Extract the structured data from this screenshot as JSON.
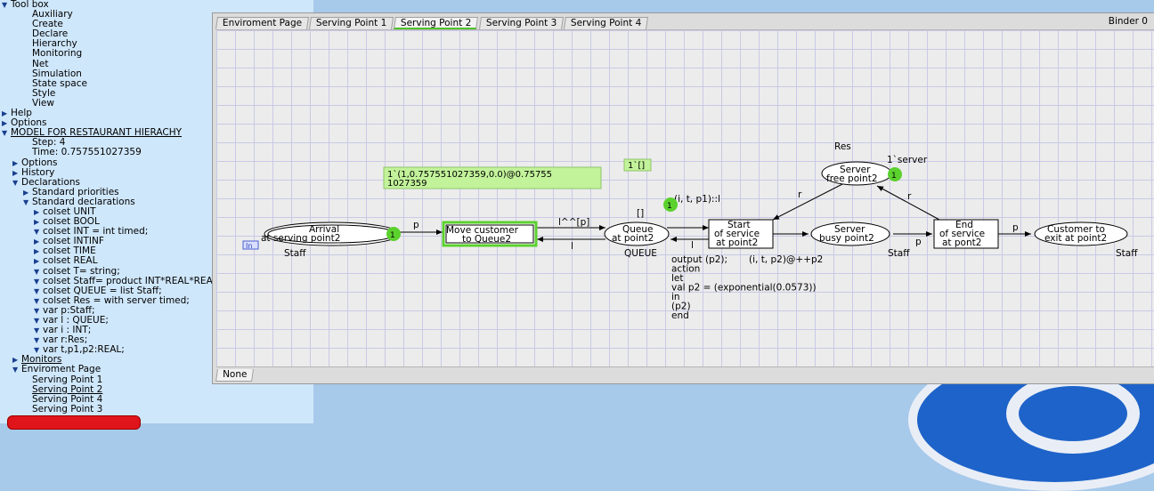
{
  "index": {
    "items": [
      {
        "label": "Tool box",
        "tri": "▼",
        "indent": 0
      },
      {
        "label": "Auxiliary",
        "tri": "",
        "indent": 2
      },
      {
        "label": "Create",
        "tri": "",
        "indent": 2
      },
      {
        "label": "Declare",
        "tri": "",
        "indent": 2
      },
      {
        "label": "Hierarchy",
        "tri": "",
        "indent": 2
      },
      {
        "label": "Monitoring",
        "tri": "",
        "indent": 2
      },
      {
        "label": "Net",
        "tri": "",
        "indent": 2
      },
      {
        "label": "Simulation",
        "tri": "",
        "indent": 2
      },
      {
        "label": "State space",
        "tri": "",
        "indent": 2
      },
      {
        "label": "Style",
        "tri": "",
        "indent": 2
      },
      {
        "label": "View",
        "tri": "",
        "indent": 2
      },
      {
        "label": "Help",
        "tri": "▶",
        "indent": 0
      },
      {
        "label": "Options",
        "tri": "▶",
        "indent": 0
      },
      {
        "label": "MODEL FOR RESTAURANT  HIERACHY",
        "tri": "▼",
        "indent": 0,
        "underline": true
      },
      {
        "label": "Step: 4",
        "tri": "",
        "indent": 2
      },
      {
        "label": "Time: 0.757551027359",
        "tri": "",
        "indent": 2
      },
      {
        "label": "Options",
        "tri": "▶",
        "indent": 1
      },
      {
        "label": "History",
        "tri": "▶",
        "indent": 1
      },
      {
        "label": "Declarations",
        "tri": "▼",
        "indent": 1
      },
      {
        "label": "Standard priorities",
        "tri": "▶",
        "indent": 2
      },
      {
        "label": "Standard declarations",
        "tri": "▼",
        "indent": 2
      },
      {
        "label": "colset UNIT",
        "tri": "▶",
        "indent": 3
      },
      {
        "label": "colset BOOL",
        "tri": "▶",
        "indent": 3
      },
      {
        "label": "colset INT = int timed;",
        "tri": "▼",
        "indent": 3
      },
      {
        "label": "colset INTINF",
        "tri": "▶",
        "indent": 3
      },
      {
        "label": "colset TIME",
        "tri": "▶",
        "indent": 3
      },
      {
        "label": "colset REAL",
        "tri": "▶",
        "indent": 3
      },
      {
        "label": "colset T= string;",
        "tri": "▼",
        "indent": 3
      },
      {
        "label": "colset Staff= product INT*REAL*REAL timed;",
        "tri": "▼",
        "indent": 3
      },
      {
        "label": "colset QUEUE = list Staff;",
        "tri": "▼",
        "indent": 3
      },
      {
        "label": "colset Res = with server timed;",
        "tri": "▼",
        "indent": 3
      },
      {
        "label": "var p:Staff;",
        "tri": "▼",
        "indent": 3
      },
      {
        "label": "var l : QUEUE;",
        "tri": "▼",
        "indent": 3
      },
      {
        "label": "var i : INT;",
        "tri": "▼",
        "indent": 3
      },
      {
        "label": "var r:Res;",
        "tri": "▼",
        "indent": 3
      },
      {
        "label": "var t,p1,p2:REAL;",
        "tri": "▼",
        "indent": 3
      },
      {
        "label": "Monitors",
        "tri": "▶",
        "indent": 1,
        "underline": true
      },
      {
        "label": "Enviroment Page",
        "tri": "▼",
        "indent": 1
      },
      {
        "label": "Serving Point 1",
        "tri": "",
        "indent": 2
      },
      {
        "label": "Serving Point 2",
        "tri": "",
        "indent": 2,
        "underline": true
      },
      {
        "label": "Serving Point 4",
        "tri": "",
        "indent": 2
      },
      {
        "label": "Serving Point 3",
        "tri": "",
        "indent": 2
      }
    ]
  },
  "binder": {
    "label": "Binder 0",
    "tabs": [
      "Enviroment Page",
      "Serving Point 1",
      "Serving Point 2",
      "Serving Point 3",
      "Serving Point 4"
    ],
    "active_tab": "Serving Point 2",
    "bottom_tab": "None"
  },
  "net": {
    "places": {
      "arrival": {
        "line1": "Arrival",
        "line2": "at serving point2",
        "type": "Staff",
        "tokens": "1",
        "port": "In"
      },
      "queue": {
        "line1": "Queue",
        "line2": "at point2",
        "type": "QUEUE",
        "tokens": "1",
        "initial": "[]"
      },
      "server_free": {
        "line1": "Server",
        "line2": "free point2",
        "type": "Res",
        "tokens": "1",
        "initial": "1`server"
      },
      "server_busy": {
        "line1": "Server",
        "line2": "busy point2",
        "type": "Staff"
      },
      "exit": {
        "line1": "Customer to",
        "line2": "exit at point2",
        "type": "Staff"
      }
    },
    "transitions": {
      "move": {
        "line1": "Move customer",
        "line2": "to Queue2"
      },
      "start": {
        "line1": "Start",
        "line2": "of service",
        "line3": "at point2"
      },
      "end": {
        "line1": "End",
        "line2": "of service",
        "line3": "at pont2"
      }
    },
    "arcs": {
      "arrival_move": "p",
      "move_queue": "l^^[p]",
      "queue_move": "l",
      "queue_start": "(i, t, p1)::l",
      "start_queue": "l",
      "free_start": "r",
      "end_free": "r",
      "start_busy": "(i, t, p2)@++p2",
      "busy_end": "p",
      "end_exit": "p"
    },
    "markings": {
      "arrival": "1`(1,0.757551027359,0.0)@0.75755\n1027359",
      "server_free": "1`[]"
    },
    "code_segment": [
      "output (p2);",
      "action",
      "let",
      "val p2 = (exponential(0.0573))",
      "in",
      "(p2)",
      "end"
    ]
  },
  "colors": {
    "token": "#5bd12e",
    "enabled": "#5bd12e",
    "marking_bg": "#c2f29a",
    "grid": "#c9c9e6"
  }
}
